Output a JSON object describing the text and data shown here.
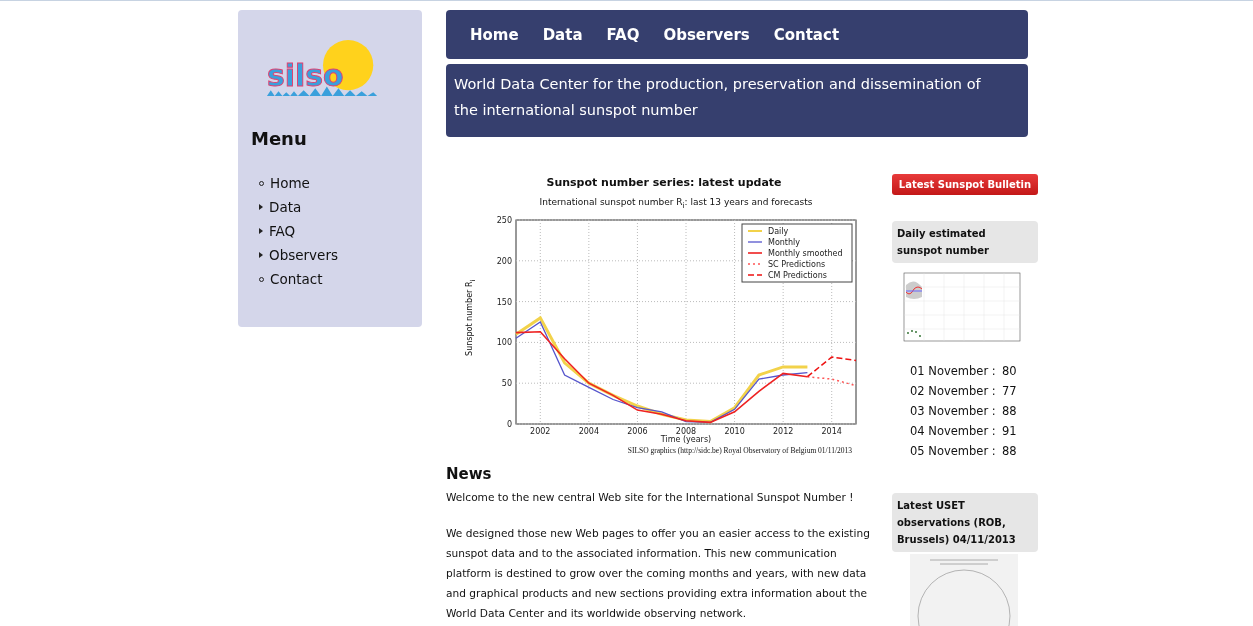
{
  "logo": {
    "text": "silso"
  },
  "menu": {
    "title": "Menu",
    "items": [
      {
        "label": "Home",
        "kind": "page"
      },
      {
        "label": "Data",
        "kind": "folder"
      },
      {
        "label": "FAQ",
        "kind": "folder"
      },
      {
        "label": "Observers",
        "kind": "folder"
      },
      {
        "label": "Contact",
        "kind": "page"
      }
    ]
  },
  "nav": [
    "Home",
    "Data",
    "FAQ",
    "Observers",
    "Contact"
  ],
  "banner": "World Data Center for the production, preservation and dissemination of the international sunspot number",
  "main_chart": {
    "heading": "Sunspot number series: latest update",
    "credit": "SILSO graphics (http://sidc.be)  Royal Observatory of Belgium  01/11/2013",
    "chart_data": {
      "type": "line",
      "title": "International sunspot number R$_{i}$: last 13 years and forecasts",
      "xlabel": "Time (years)",
      "ylabel": "Sunspot number R$_{i}$",
      "x": [
        2001,
        2002,
        2003,
        2004,
        2005,
        2006,
        2007,
        2008,
        2009,
        2010,
        2011,
        2012,
        2013,
        2014,
        2015
      ],
      "grid": true,
      "legend": true,
      "xlim": [
        2001,
        2015
      ],
      "ylim": [
        0,
        250
      ],
      "xticks": [
        2002,
        2004,
        2006,
        2008,
        2010,
        2012,
        2014
      ],
      "yticks": [
        0,
        50,
        100,
        150,
        200,
        250
      ],
      "series": [
        {
          "name": "Daily",
          "color": "#f2d24a",
          "values": [
            110,
            130,
            75,
            50,
            35,
            22,
            12,
            5,
            3,
            20,
            60,
            70,
            70,
            null,
            null
          ]
        },
        {
          "name": "Monthly",
          "color": "#5555cc",
          "values": [
            105,
            125,
            60,
            45,
            30,
            20,
            15,
            3,
            2,
            18,
            55,
            60,
            63,
            null,
            null
          ]
        },
        {
          "name": "Monthly smoothed",
          "color": "#ee2222",
          "values": [
            112,
            113,
            80,
            50,
            35,
            17,
            12,
            4,
            2,
            15,
            40,
            62,
            58,
            null,
            null
          ]
        },
        {
          "name": "SC Predictions",
          "color": "#ff5555",
          "line_style": "dotted",
          "values": [
            null,
            null,
            null,
            null,
            null,
            null,
            null,
            null,
            null,
            null,
            null,
            null,
            58,
            55,
            47
          ]
        },
        {
          "name": "CM Predictions",
          "color": "#ee1111",
          "line_style": "dashed",
          "values": [
            null,
            null,
            null,
            null,
            null,
            null,
            null,
            null,
            null,
            null,
            null,
            null,
            58,
            82,
            78
          ]
        }
      ]
    }
  },
  "news": {
    "title": "News",
    "paragraphs": [
      "Welcome to the new central Web site for the International Sunspot Number !",
      "We designed those new Web pages to offer you an easier access to the existing sunspot data and to the associated information. This new communication platform is destined to grow over the coming months and years, with new data and graphical products and new sections providing extra information about the World Data Center and its worldwide observing network."
    ]
  },
  "bulletin_button": "Latest Sunspot Bulletin",
  "daily_box": {
    "title": "Daily estimated sunspot number",
    "rows": [
      {
        "date": "01 November :",
        "value": "80"
      },
      {
        "date": "02 November :",
        "value": "77"
      },
      {
        "date": "03 November :",
        "value": "88"
      },
      {
        "date": "04 November :",
        "value": "91"
      },
      {
        "date": "05 November :",
        "value": "88"
      }
    ]
  },
  "uset_box": {
    "title": "Latest USET observations (ROB, Brussels) 04/11/2013"
  }
}
